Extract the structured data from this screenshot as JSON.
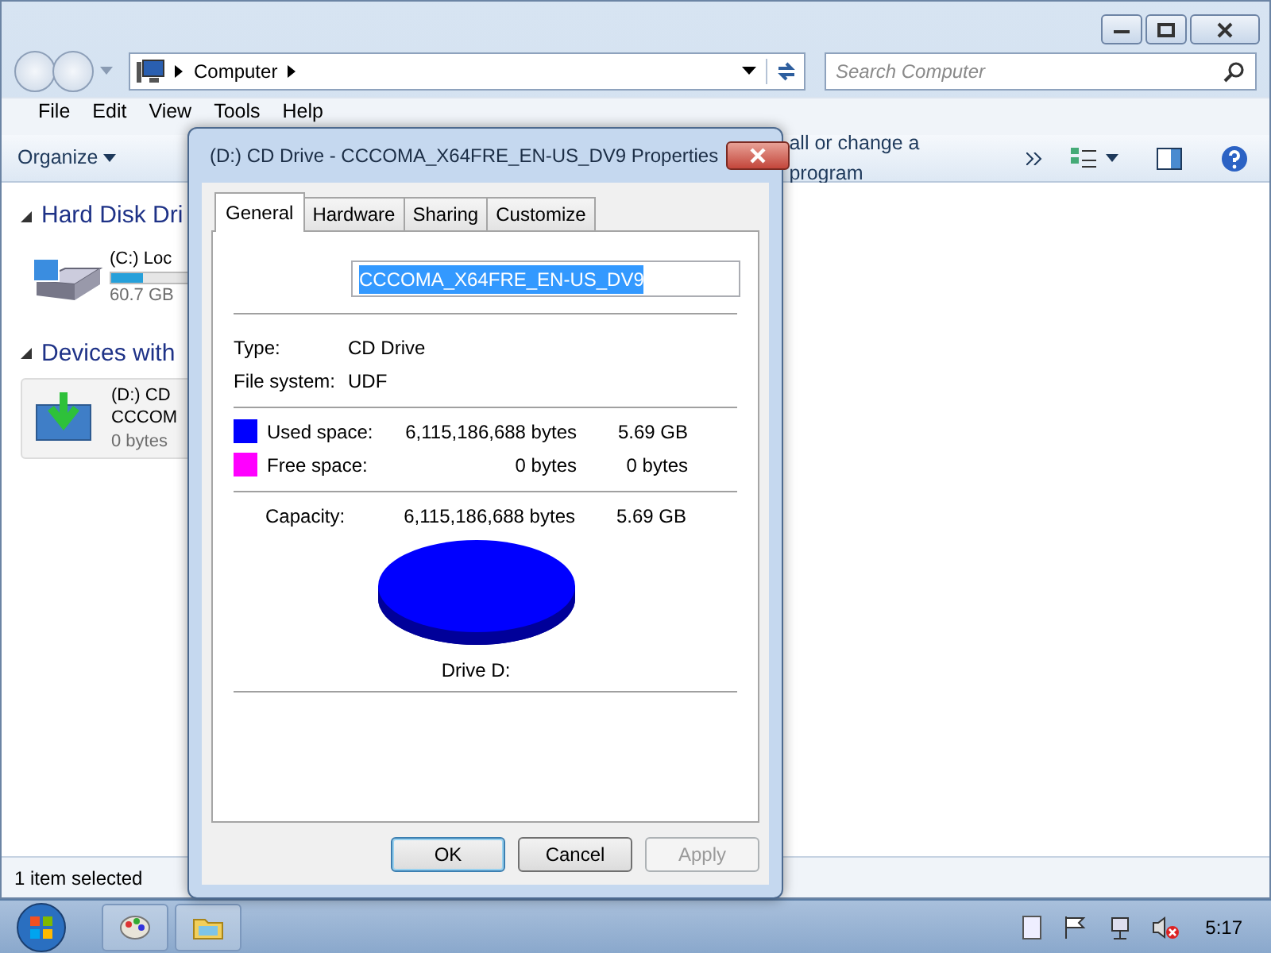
{
  "explorer": {
    "address": "Computer",
    "search": {
      "placeholder": "Search Computer"
    },
    "menu": [
      "File",
      "Edit",
      "View",
      "Tools",
      "Help"
    ],
    "toolbar": [
      "Organize",
      "all or change a program"
    ],
    "groups": [
      {
        "title": "Hard Disk Dri",
        "items": [
          {
            "kind": "disk",
            "name": "(C:) Loc",
            "size": "60.7 GB",
            "level": 0.35
          }
        ]
      },
      {
        "title": "Devices with",
        "items": [
          {
            "kind": "cd",
            "name": "(D:) CD",
            "label": "CCCOM",
            "size": "0 bytes",
            "selected": true
          }
        ]
      }
    ],
    "status_bar": "1 item selected"
  },
  "dialog": {
    "title": "(D:) CD Drive - CCCOMA_X64FRE_EN-US_DV9 Properties",
    "tabs": [
      {
        "label": "General",
        "selected": true
      },
      {
        "label": "Hardware",
        "selected": false
      },
      {
        "label": "Sharing",
        "selected": false
      },
      {
        "label": "Customize",
        "selected": false
      }
    ],
    "volume_name": "CCCOMA_X64FRE_EN-US_DV9",
    "info": [
      {
        "label": "Type:",
        "value": "CD Drive"
      },
      {
        "label": "File system:",
        "value": "UDF"
      }
    ],
    "space": [
      {
        "label": "Used space:",
        "bytes": "6,115,186,688 bytes",
        "size": "5.69 GB",
        "color": "#0000ff"
      },
      {
        "label": "Free space:",
        "bytes": "0 bytes",
        "size": "0 bytes",
        "color": "#ff00ff"
      }
    ],
    "capacity": {
      "label": "Capacity:",
      "bytes": "6,115,186,688 bytes",
      "size": "5.69 GB"
    },
    "drive_label": "Drive D:",
    "buttons": [
      {
        "label": "OK",
        "default": true,
        "disabled": false
      },
      {
        "label": "Cancel",
        "default": false,
        "disabled": false
      },
      {
        "label": "Apply",
        "default": false,
        "disabled": true
      }
    ]
  },
  "taskbar": {
    "clock": "5:17"
  }
}
